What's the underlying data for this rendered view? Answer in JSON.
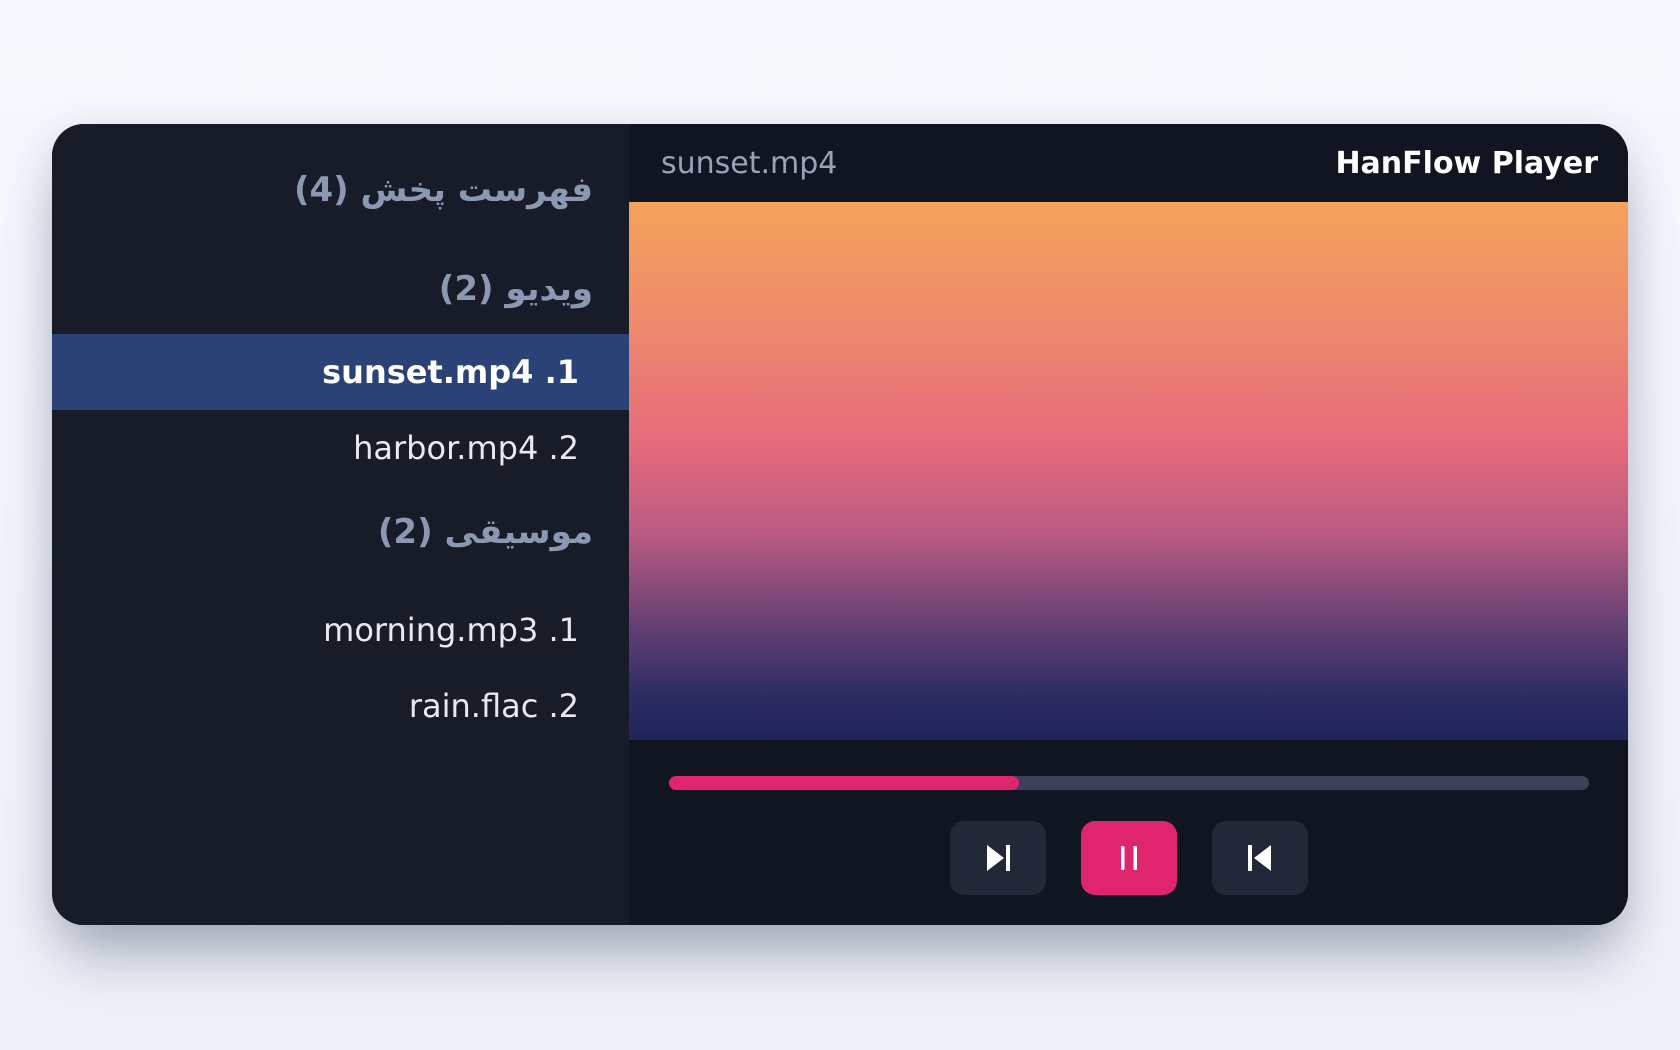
{
  "app_title": "HanFlow Player",
  "now_playing": "sunset.mp4",
  "playlist": {
    "title": "فهرست پخش (4)",
    "groups": [
      {
        "label": "ویدیو (2)",
        "items": [
          "sunset.mp4 .1",
          "harbor.mp4 .2"
        ]
      },
      {
        "label": "موسیقی (2)",
        "items": [
          "morning.mp3 .1",
          "rain.flac .2"
        ]
      }
    ],
    "active_item": "sunset.mp4 .1"
  },
  "progress": {
    "fraction": 0.38
  },
  "controls": {
    "left": "next-track-icon",
    "center": "pause-icon",
    "right": "previous-track-icon"
  },
  "colors": {
    "accent": "#e0256f",
    "active_row": "#2a4275",
    "panel": "#181c28",
    "background": "#111521"
  }
}
